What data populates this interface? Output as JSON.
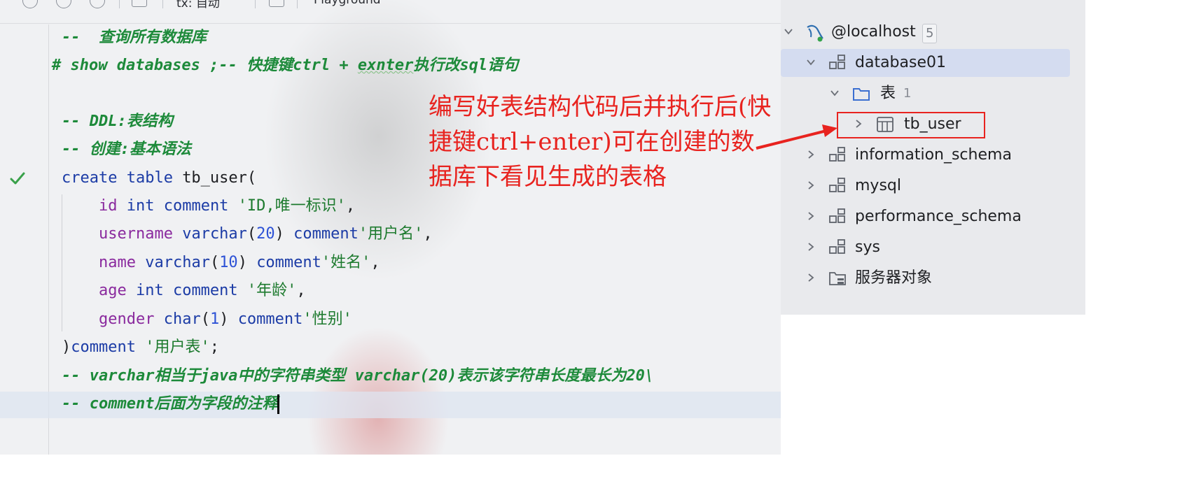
{
  "toolbar": {
    "schema_selector": "tx: 自动",
    "console_selector": "Playground"
  },
  "editor": {
    "lines": [
      {
        "parts": [
          {
            "t": "--  查询所有数据库",
            "c": "cm"
          }
        ]
      },
      {
        "parts": [
          {
            "t": "# show databases ;-- 快捷键ctrl + ",
            "c": "cm"
          },
          {
            "t": "exnter",
            "c": "cm squig"
          },
          {
            "t": "执行改sql语句",
            "c": "cm"
          }
        ]
      },
      {
        "parts": []
      },
      {
        "parts": [
          {
            "t": "-- DDL:表结构",
            "c": "cm"
          }
        ]
      },
      {
        "parts": [
          {
            "t": "-- 创建:基本语法",
            "c": "cm"
          }
        ]
      },
      {
        "parts": [
          {
            "t": "create table ",
            "c": "kw"
          },
          {
            "t": "tb_user(",
            "c": "plain"
          }
        ]
      },
      {
        "parts": [
          {
            "t": "    ",
            "c": "plain"
          },
          {
            "t": "id ",
            "c": "col"
          },
          {
            "t": "int comment ",
            "c": "kw"
          },
          {
            "t": "'ID,唯一标识'",
            "c": "str"
          },
          {
            "t": ",",
            "c": "plain"
          }
        ]
      },
      {
        "parts": [
          {
            "t": "    ",
            "c": "plain"
          },
          {
            "t": "username ",
            "c": "col"
          },
          {
            "t": "varchar",
            "c": "kw"
          },
          {
            "t": "(",
            "c": "plain"
          },
          {
            "t": "20",
            "c": "num"
          },
          {
            "t": ") ",
            "c": "plain"
          },
          {
            "t": "comment",
            "c": "kw"
          },
          {
            "t": "'用户名'",
            "c": "str"
          },
          {
            "t": ",",
            "c": "plain"
          }
        ]
      },
      {
        "parts": [
          {
            "t": "    ",
            "c": "plain"
          },
          {
            "t": "name ",
            "c": "col"
          },
          {
            "t": "varchar",
            "c": "kw"
          },
          {
            "t": "(",
            "c": "plain"
          },
          {
            "t": "10",
            "c": "num"
          },
          {
            "t": ") ",
            "c": "plain"
          },
          {
            "t": "comment",
            "c": "kw"
          },
          {
            "t": "'姓名'",
            "c": "str"
          },
          {
            "t": ",",
            "c": "plain"
          }
        ]
      },
      {
        "parts": [
          {
            "t": "    ",
            "c": "plain"
          },
          {
            "t": "age ",
            "c": "col"
          },
          {
            "t": "int comment ",
            "c": "kw"
          },
          {
            "t": "'年龄'",
            "c": "str"
          },
          {
            "t": ",",
            "c": "plain"
          }
        ]
      },
      {
        "parts": [
          {
            "t": "    ",
            "c": "plain"
          },
          {
            "t": "gender ",
            "c": "col"
          },
          {
            "t": "char",
            "c": "kw"
          },
          {
            "t": "(",
            "c": "plain"
          },
          {
            "t": "1",
            "c": "num"
          },
          {
            "t": ") ",
            "c": "plain"
          },
          {
            "t": "comment",
            "c": "kw"
          },
          {
            "t": "'性别'",
            "c": "str"
          }
        ]
      },
      {
        "parts": [
          {
            "t": ")",
            "c": "plain"
          },
          {
            "t": "comment ",
            "c": "kw"
          },
          {
            "t": "'用户表'",
            "c": "str"
          },
          {
            "t": ";",
            "c": "plain"
          }
        ]
      },
      {
        "parts": [
          {
            "t": "-- varchar相当于java中的字符串类型 varchar(20)表示该字符串长度最长为20\\",
            "c": "cm"
          }
        ]
      },
      {
        "parts": [
          {
            "t": "-- comment后面为字段的注释",
            "c": "cm"
          }
        ]
      }
    ]
  },
  "annotation": {
    "text": "编写好表结构代码后并执行后(快捷键ctrl+enter)可在创建的数据库下看见生成的表格"
  },
  "tree": {
    "host": {
      "label": "@localhost",
      "count": "5"
    },
    "database01": {
      "label": "database01"
    },
    "tables_folder": {
      "label": "表",
      "count": "1"
    },
    "tb_user": {
      "label": "tb_user"
    },
    "information_schema": {
      "label": "information_schema"
    },
    "mysql": {
      "label": "mysql"
    },
    "performance_schema": {
      "label": "performance_schema"
    },
    "sys": {
      "label": "sys"
    },
    "server_objects": {
      "label": "服务器对象"
    }
  },
  "colors": {
    "comment": "#1d8a3a",
    "keyword": "#1c3ca6",
    "column": "#8a2a9e",
    "string": "#1d7a2e",
    "number": "#2d52d6",
    "annotation": "#e8231f",
    "selection": "#d4dcf0"
  },
  "icons": [
    "circle-icon",
    "help-icon",
    "puzzle-icon",
    "list-icon",
    "console-icon",
    "checkmark-icon",
    "chevron-down-icon",
    "chevron-right-icon",
    "mysql-dolphin-icon",
    "schema-icon",
    "folder-icon",
    "table-icon",
    "server-objects-icon"
  ]
}
